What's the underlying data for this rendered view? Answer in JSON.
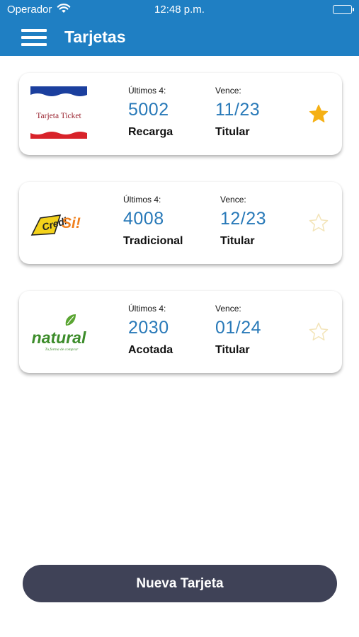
{
  "status_bar": {
    "carrier": "Operador",
    "time": "12:48 p.m."
  },
  "header": {
    "title": "Tarjetas"
  },
  "cards": [
    {
      "logo_text": "Tarjeta Ticket",
      "last4_label": "Últimos 4:",
      "last4": "5002",
      "type": "Recarga",
      "expiry_label": "Vence:",
      "expiry": "11/23",
      "holder": "Titular",
      "favorite": true
    },
    {
      "logo_text": "CrediSi!",
      "last4_label": "Últimos 4:",
      "last4": "4008",
      "type": "Tradicional",
      "expiry_label": "Vence:",
      "expiry": "12/23",
      "holder": "Titular",
      "favorite": false
    },
    {
      "logo_text": "natural",
      "logo_tagline": "Tu forma de comprar",
      "last4_label": "Últimos 4:",
      "last4": "2030",
      "type": "Acotada",
      "expiry_label": "Vence:",
      "expiry": "01/24",
      "holder": "Titular",
      "favorite": false
    }
  ],
  "actions": {
    "new_card_label": "Nueva Tarjeta"
  },
  "colors": {
    "header_bg": "#1f7fc3",
    "number_blue": "#2879b8",
    "star_active": "#f5b015",
    "star_inactive": "#f3e4b8",
    "button_bg": "#3f4257"
  }
}
